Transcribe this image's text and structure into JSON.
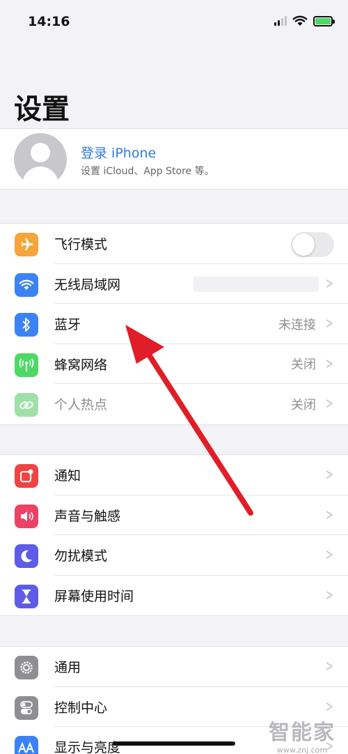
{
  "status_bar": {
    "time": "14:16"
  },
  "page_title": "设置",
  "profile": {
    "title": "登录 iPhone",
    "subtitle": "设置 iCloud、App Store 等。"
  },
  "group1": [
    {
      "label": "飞行模式",
      "icon": "airplane-icon",
      "color": "#f5a53c",
      "type": "toggle",
      "toggle_on": false
    },
    {
      "label": "无线局域网",
      "icon": "wifi-icon",
      "color": "#3b82f6",
      "type": "chevron",
      "value": ""
    },
    {
      "label": "蓝牙",
      "icon": "bluetooth-icon",
      "color": "#3b82f6",
      "type": "chevron",
      "value": "未连接"
    },
    {
      "label": "蜂窝网络",
      "icon": "cellular-antenna-icon",
      "color": "#4cd964",
      "type": "chevron",
      "value": "关闭"
    },
    {
      "label": "个人热点",
      "icon": "hotspot-link-icon",
      "color": "#9ee0a8",
      "type": "chevron",
      "value": "关闭",
      "dimmed": true
    }
  ],
  "group2": [
    {
      "label": "通知",
      "icon": "notification-icon",
      "color": "#ef4444"
    },
    {
      "label": "声音与触感",
      "icon": "speaker-icon",
      "color": "#ec4266"
    },
    {
      "label": "勿扰模式",
      "icon": "moon-icon",
      "color": "#5e5ce6"
    },
    {
      "label": "屏幕使用时间",
      "icon": "hourglass-icon",
      "color": "#5e5ce6"
    }
  ],
  "group3": [
    {
      "label": "通用",
      "icon": "gear-icon",
      "color": "#8e8e93"
    },
    {
      "label": "控制中心",
      "icon": "toggles-icon",
      "color": "#8e8e93"
    },
    {
      "label": "显示与亮度",
      "icon": "text-size-icon",
      "color": "#3b82f6"
    }
  ],
  "watermark": {
    "main": "智能家",
    "sub": "www.znj.com"
  },
  "annotation": {
    "arrow_color": "#e11d27"
  }
}
